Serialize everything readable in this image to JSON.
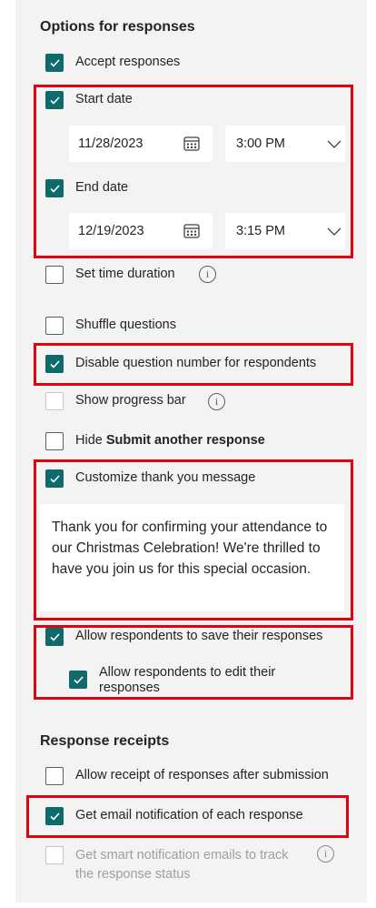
{
  "options": {
    "heading": "Options for responses",
    "accept_responses": {
      "label": "Accept responses",
      "checked": true
    },
    "start_date": {
      "label": "Start date",
      "checked": true,
      "date": "11/28/2023",
      "time": "3:00 PM"
    },
    "end_date": {
      "label": "End date",
      "checked": true,
      "date": "12/19/2023",
      "time": "3:15 PM"
    },
    "set_time_duration": {
      "label": "Set time duration",
      "checked": false
    },
    "shuffle_questions": {
      "label": "Shuffle questions",
      "checked": false
    },
    "disable_question_number": {
      "label": "Disable question number for respondents",
      "checked": true
    },
    "show_progress_bar": {
      "label": "Show progress bar",
      "checked": false
    },
    "hide_submit_another": {
      "label_prefix": "Hide",
      "label_bold": "Submit another response",
      "checked": false
    },
    "customize_thank_you": {
      "label": "Customize thank you message",
      "checked": true,
      "message": "Thank you for confirming your attendance to our Christmas Celebration! We're thrilled to have you join us for this special occasion."
    },
    "allow_save": {
      "label": "Allow respondents to save their responses",
      "checked": true
    },
    "allow_edit": {
      "label_line1": "Allow respondents to edit their",
      "label_line2": "responses",
      "checked": true
    }
  },
  "receipts": {
    "heading": "Response receipts",
    "allow_receipt": {
      "label": "Allow receipt of responses after submission",
      "checked": false
    },
    "email_notification": {
      "label": "Get email notification of each response",
      "checked": true
    },
    "smart_notification": {
      "label_line1": "Get smart notification emails to track",
      "label_line2": "the response status",
      "checked": false,
      "disabled": true
    }
  },
  "icons": {
    "info_glyph": "i",
    "checkmark": "check-icon",
    "calendar": "calendar-icon",
    "dropdown": "chevron-down-icon"
  },
  "colors": {
    "accent": "#0f6b6b",
    "highlight": "#e3000f",
    "panel_bg": "#f3f3f3"
  }
}
